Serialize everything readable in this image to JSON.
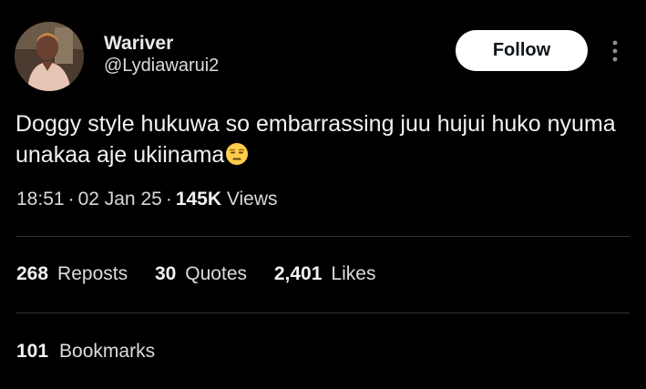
{
  "author": {
    "display_name": "Wariver",
    "handle": "@Lydiawarui2"
  },
  "follow_button": {
    "label": "Follow"
  },
  "tweet": {
    "text": "Doggy style hukuwa so embarrassing juu hujui huko nyuma unakaa aje ukiinama",
    "emoji": "expressionless-face-emoji"
  },
  "meta": {
    "time": "18:51",
    "date": "02 Jan 25",
    "separator": "·",
    "views_count": "145K",
    "views_label": "Views"
  },
  "stats": {
    "reposts": {
      "count": "268",
      "label": "Reposts"
    },
    "quotes": {
      "count": "30",
      "label": "Quotes"
    },
    "likes": {
      "count": "2,401",
      "label": "Likes"
    },
    "bookmarks": {
      "count": "101",
      "label": "Bookmarks"
    }
  },
  "icons": {
    "avatar": "profile-photo",
    "more": "more-vertical-icon"
  },
  "colors": {
    "background": "#000000",
    "text": "#e7e9ea",
    "secondary_text": "#dcdcdc",
    "divider": "#2f3336",
    "follow_bg": "#ffffff",
    "follow_text": "#0f1419"
  }
}
